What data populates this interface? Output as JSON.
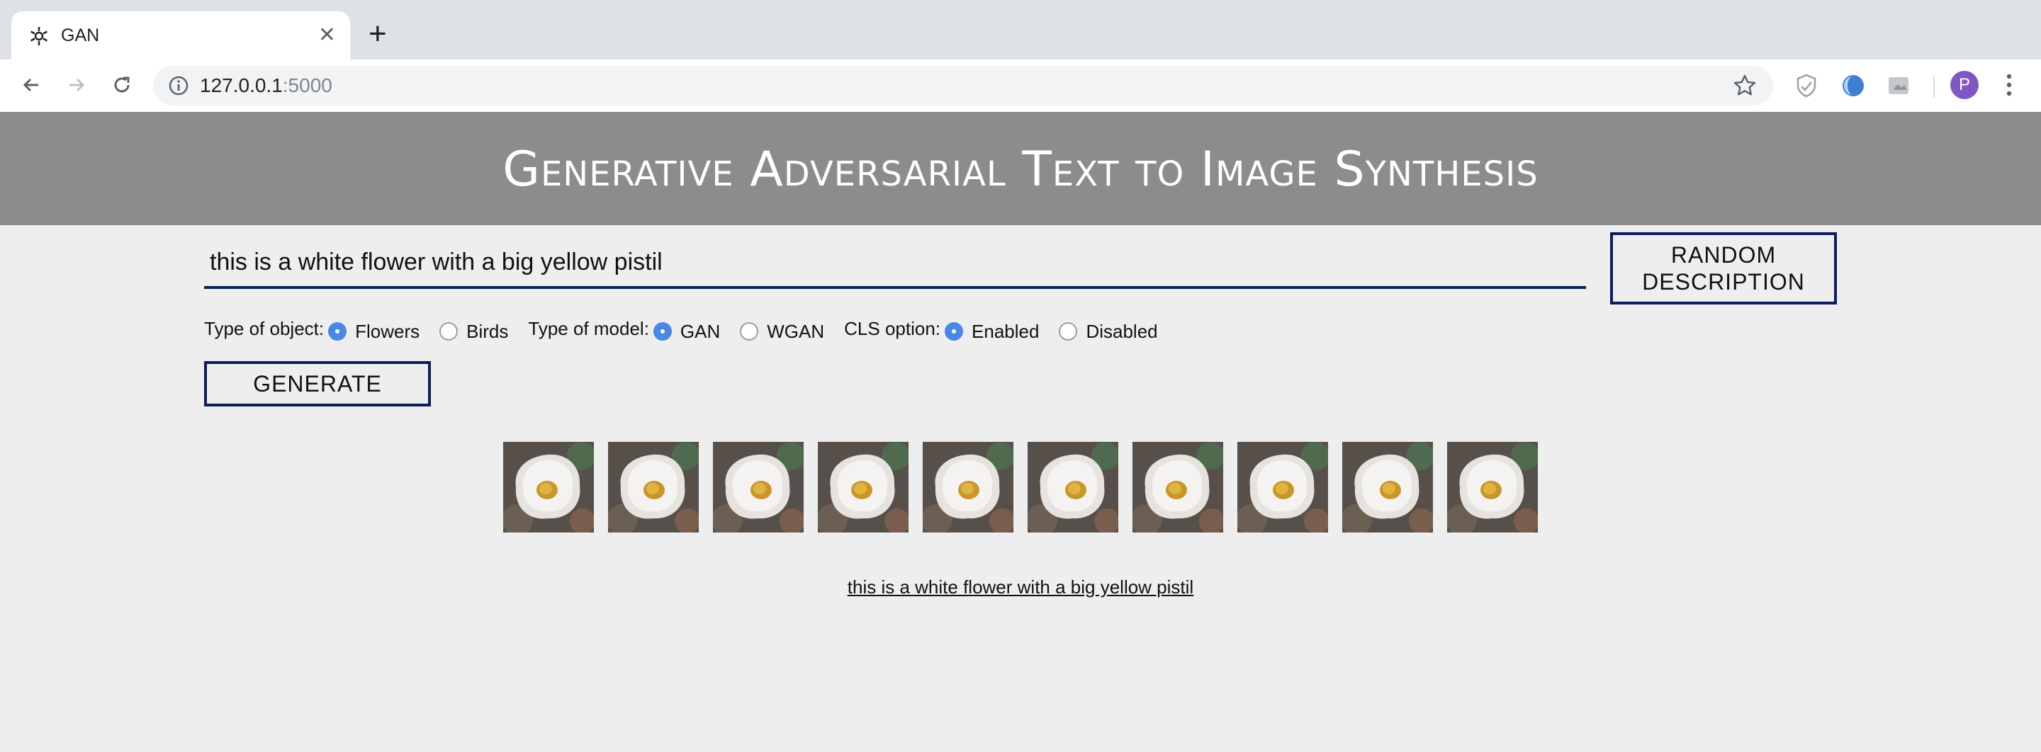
{
  "browser": {
    "tab_title": "GAN",
    "url_host": "127.0.0.1",
    "url_port": ":5000",
    "avatar_letter": "P"
  },
  "page": {
    "title": "Generative Adversarial Text to Image Synthesis",
    "description_value": "this is a white flower with a big yellow pistil",
    "random_button": "Random Description",
    "generate_button": "Generate",
    "options": {
      "object_label": "Type of object:",
      "object_choices": [
        "Flowers",
        "Birds"
      ],
      "object_selected": "Flowers",
      "model_label": "Type of model:",
      "model_choices": [
        "GAN",
        "WGAN"
      ],
      "model_selected": "GAN",
      "cls_label": "CLS option:",
      "cls_choices": [
        "Enabled",
        "Disabled"
      ],
      "cls_selected": "Enabled"
    },
    "generated_image_count": 10,
    "caption": "this is a white flower with a big yellow pistil"
  },
  "colors": {
    "banner": "#8c8c8c",
    "accent_border": "#0c1e5b",
    "radio_selected": "#4a88e8",
    "avatar": "#7e57c2"
  }
}
